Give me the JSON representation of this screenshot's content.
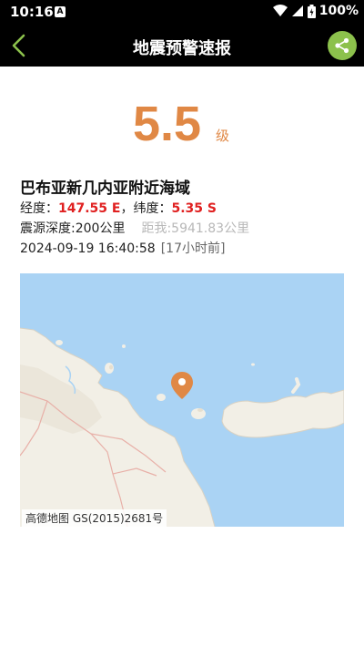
{
  "status_bar": {
    "time": "10:16",
    "battery": "100%"
  },
  "header": {
    "title": "地震预警速报"
  },
  "quake": {
    "magnitude": "5.5",
    "magnitude_unit": "级",
    "location": "巴布亚新几内亚附近海域",
    "longitude_label": "经度：",
    "longitude": "147.55 E",
    "latitude_label": "，纬度：",
    "latitude": "5.35 S",
    "depth": "震源深度:200公里",
    "distance": "距我:5941.83公里",
    "datetime": "2024-09-19 16:40:58",
    "ago": "[17小时前]"
  },
  "map": {
    "attribution": "高德地图 GS(2015)2681号",
    "marker_icon": "location-pin-icon"
  },
  "colors": {
    "accent": "#e08845",
    "coord": "#e02020",
    "share": "#8cc14c",
    "back": "#8cc14c",
    "sea": "#aad3f4",
    "land": "#f2efe6"
  }
}
